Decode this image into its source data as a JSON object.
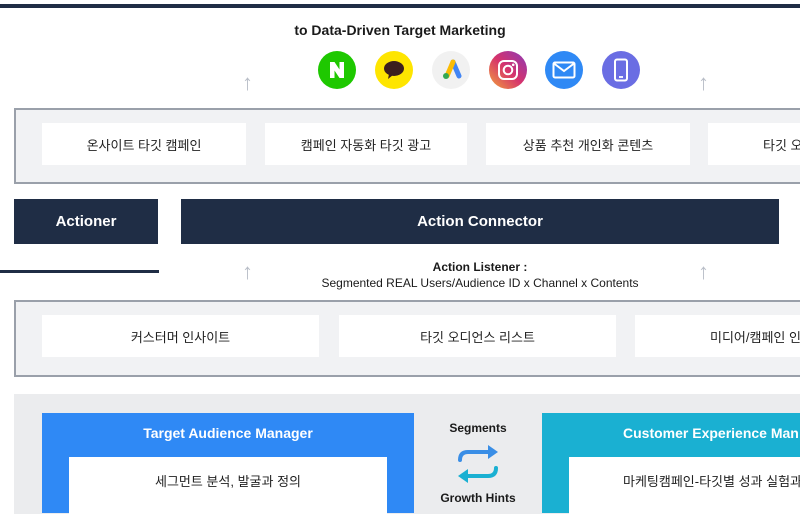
{
  "header": {
    "title": "to Data-Driven Target Marketing"
  },
  "channels": [
    {
      "name": "naver-icon",
      "color": "#1ec800"
    },
    {
      "name": "kakaotalk-icon",
      "color": "#fee500"
    },
    {
      "name": "google-ads-icon",
      "color": "#f1f1f1"
    },
    {
      "name": "instagram-icon",
      "color": "#d6336c"
    },
    {
      "name": "email-icon",
      "color": "#2f89f5"
    },
    {
      "name": "mobile-app-icon",
      "color": "#6a6de3"
    }
  ],
  "action_row": {
    "items": [
      "온사이트 타깃 캠페인",
      "캠페인 자동화 타깃 광고",
      "상품 추천 개인화 콘텐츠",
      "타깃 오"
    ]
  },
  "actioner": {
    "label": "Actioner"
  },
  "action_connector": {
    "label": "Action Connector"
  },
  "action_listener": {
    "title": "Action Listener :",
    "subtitle": "Segmented REAL Users/Audience ID x Channel x Contents"
  },
  "insight_row": {
    "items": [
      "커스터머 인사이트",
      "타깃 오디언스 리스트",
      "미디어/캠페인 인"
    ]
  },
  "target_audience_manager": {
    "title": "Target Audience Manager",
    "content": "세그먼트 분석, 발굴과 정의",
    "color": "#2f89f5"
  },
  "exchange": {
    "top": "Segments",
    "bottom": "Growth Hints"
  },
  "customer_experience_manager": {
    "title": "Customer Experience Man",
    "content": "마케팅캠페인-타깃별 성과 실험과",
    "color": "#1ab0d2"
  },
  "colors": {
    "navy": "#1f2d45",
    "band_border": "#9aa0aa",
    "arrow": "#b9bec8"
  }
}
